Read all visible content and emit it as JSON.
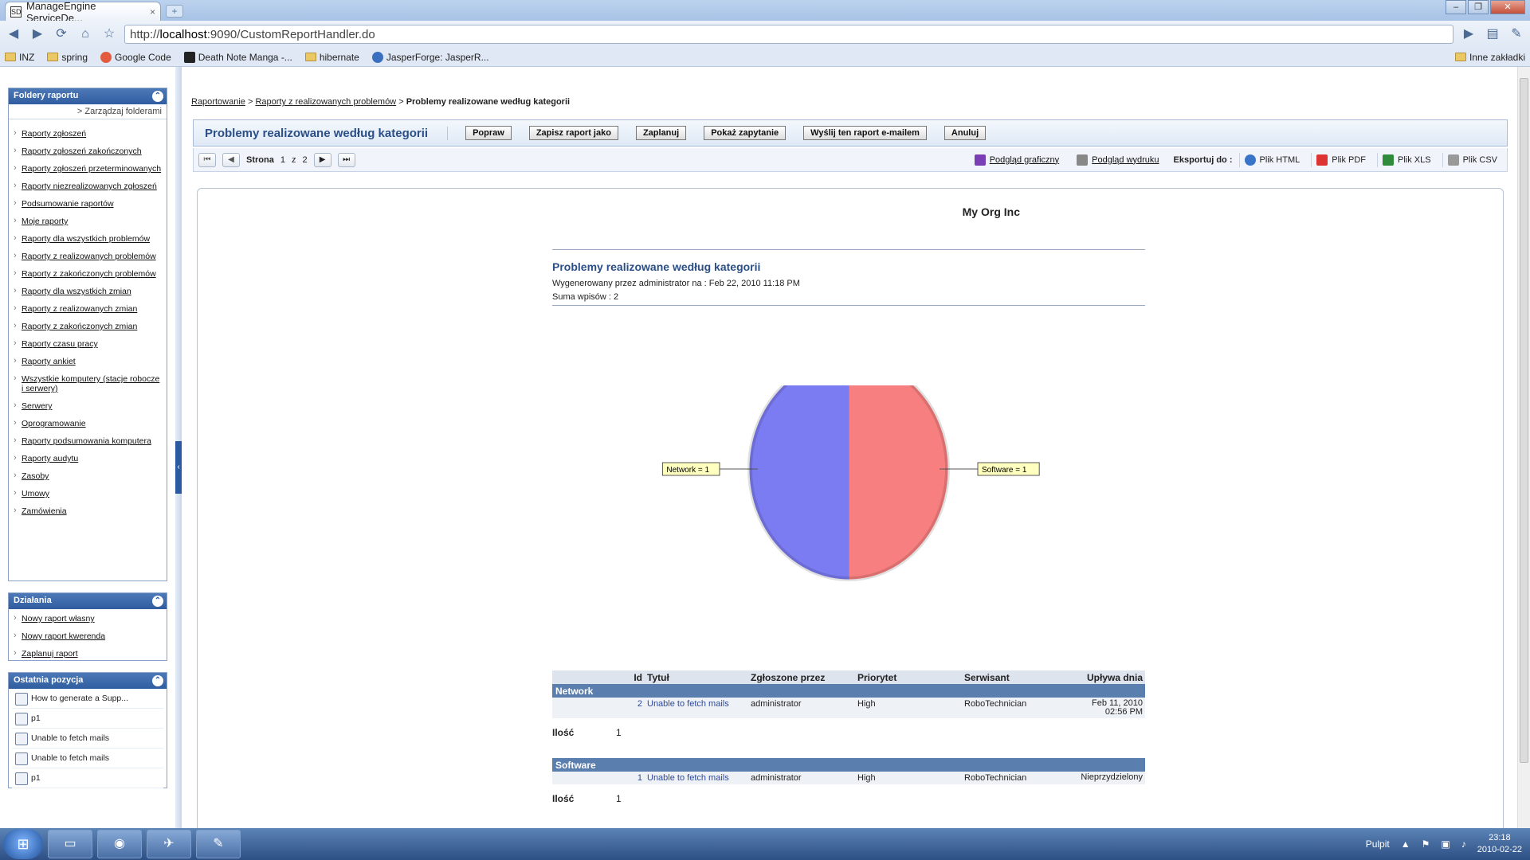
{
  "browser": {
    "tab_title": "ManageEngine ServiceDe...",
    "tab_close": "×",
    "new_tab": "+",
    "url_prefix": "http://",
    "url_host": "localhost",
    "url_rest": ":9090/CustomReportHandler.do",
    "bookmarks": [
      "INZ",
      "spring",
      "Google Code",
      "Death Note Manga -...",
      "hibernate",
      "JasperForge: JasperR..."
    ],
    "other_bookmarks": "Inne zakładki"
  },
  "sidebar": {
    "folders_title": "Foldery raportu",
    "manage_link": "> Zarządzaj folderami",
    "folders": [
      "Raporty zgłoszeń",
      "Raporty zgłoszeń zakończonych",
      "Raporty zgłoszeń przeterminowanych",
      "Raporty niezrealizowanych zgłoszeń",
      "Podsumowanie raportów",
      "Moje raporty",
      "Raporty dla wszystkich problemów",
      "Raporty z realizowanych problemów",
      "Raporty z zakończonych problemów",
      "Raporty dla wszystkich zmian",
      "Raporty z realizowanych zmian",
      "Raporty z zakończonych zmian",
      "Raporty czasu pracy",
      "Raporty ankiet",
      "Wszystkie komputery (stacje robocze i serwery)",
      "Serwery",
      "Oprogramowanie",
      "Raporty podsumowania komputera",
      "Raporty audytu",
      "Zasoby",
      "Umowy",
      "Zamówienia"
    ],
    "actions_title": "Działania",
    "actions": [
      "Nowy raport własny",
      "Nowy raport kwerenda",
      "Zaplanuj raport"
    ],
    "recent_title": "Ostatnia pozycja",
    "recent": [
      "How to generate a Supp...",
      "p1",
      "Unable to fetch mails",
      "Unable to fetch mails",
      "p1"
    ]
  },
  "breadcrumb": {
    "root": "Raportowanie",
    "sep": ">",
    "folder": "Raporty z realizowanych problemów",
    "current": "Problemy realizowane według kategorii"
  },
  "report_header": {
    "title": "Problemy realizowane według kategorii",
    "buttons": [
      "Popraw",
      "Zapisz raport jako",
      "Zaplanuj",
      "Pokaż zapytanie",
      "Wyślij ten raport e-mailem",
      "Anuluj"
    ]
  },
  "pager": {
    "label": "Strona",
    "current": "1",
    "of": "z",
    "total": "2",
    "graph_view": "Podgląd graficzny",
    "print_view": "Podgląd wydruku",
    "export_label": "Eksportuj do :",
    "formats": [
      "Plik HTML",
      "Plik PDF",
      "Plik XLS",
      "Plik CSV"
    ]
  },
  "report": {
    "org": "My Org Inc",
    "title": "Problemy realizowane według kategorii",
    "generated": "Wygenerowany przez administrator  na : Feb 22, 2010 11:18 PM",
    "total": "Suma wpisów : 2"
  },
  "chart_data": {
    "type": "pie",
    "slices": [
      {
        "label": "Network = 1",
        "name": "Network",
        "value": 1,
        "color": "#7b7bf2"
      },
      {
        "label": "Software = 1",
        "name": "Software",
        "value": 1,
        "color": "#f77f7f"
      }
    ]
  },
  "table": {
    "headers": [
      "",
      "Id",
      "Tytuł",
      "Zgłoszone przez",
      "Priorytet",
      "Serwisant",
      "Upływa dnia"
    ],
    "count_label": "Ilość",
    "groups": [
      {
        "name": "Network",
        "rows": [
          {
            "id": "2",
            "title": "Unable to fetch mails",
            "by": "administrator",
            "priority": "High",
            "tech": "RoboTechnician",
            "due": "Feb 11, 2010 02:56 PM"
          }
        ],
        "count": "1"
      },
      {
        "name": "Software",
        "rows": [
          {
            "id": "1",
            "title": "Unable to fetch mails",
            "by": "administrator",
            "priority": "High",
            "tech": "RoboTechnician",
            "due": "Nieprzydzielony"
          }
        ],
        "count": "1"
      }
    ]
  },
  "taskbar": {
    "desktop": "Pulpit",
    "time": "23:18",
    "date": "2010-02-22"
  }
}
